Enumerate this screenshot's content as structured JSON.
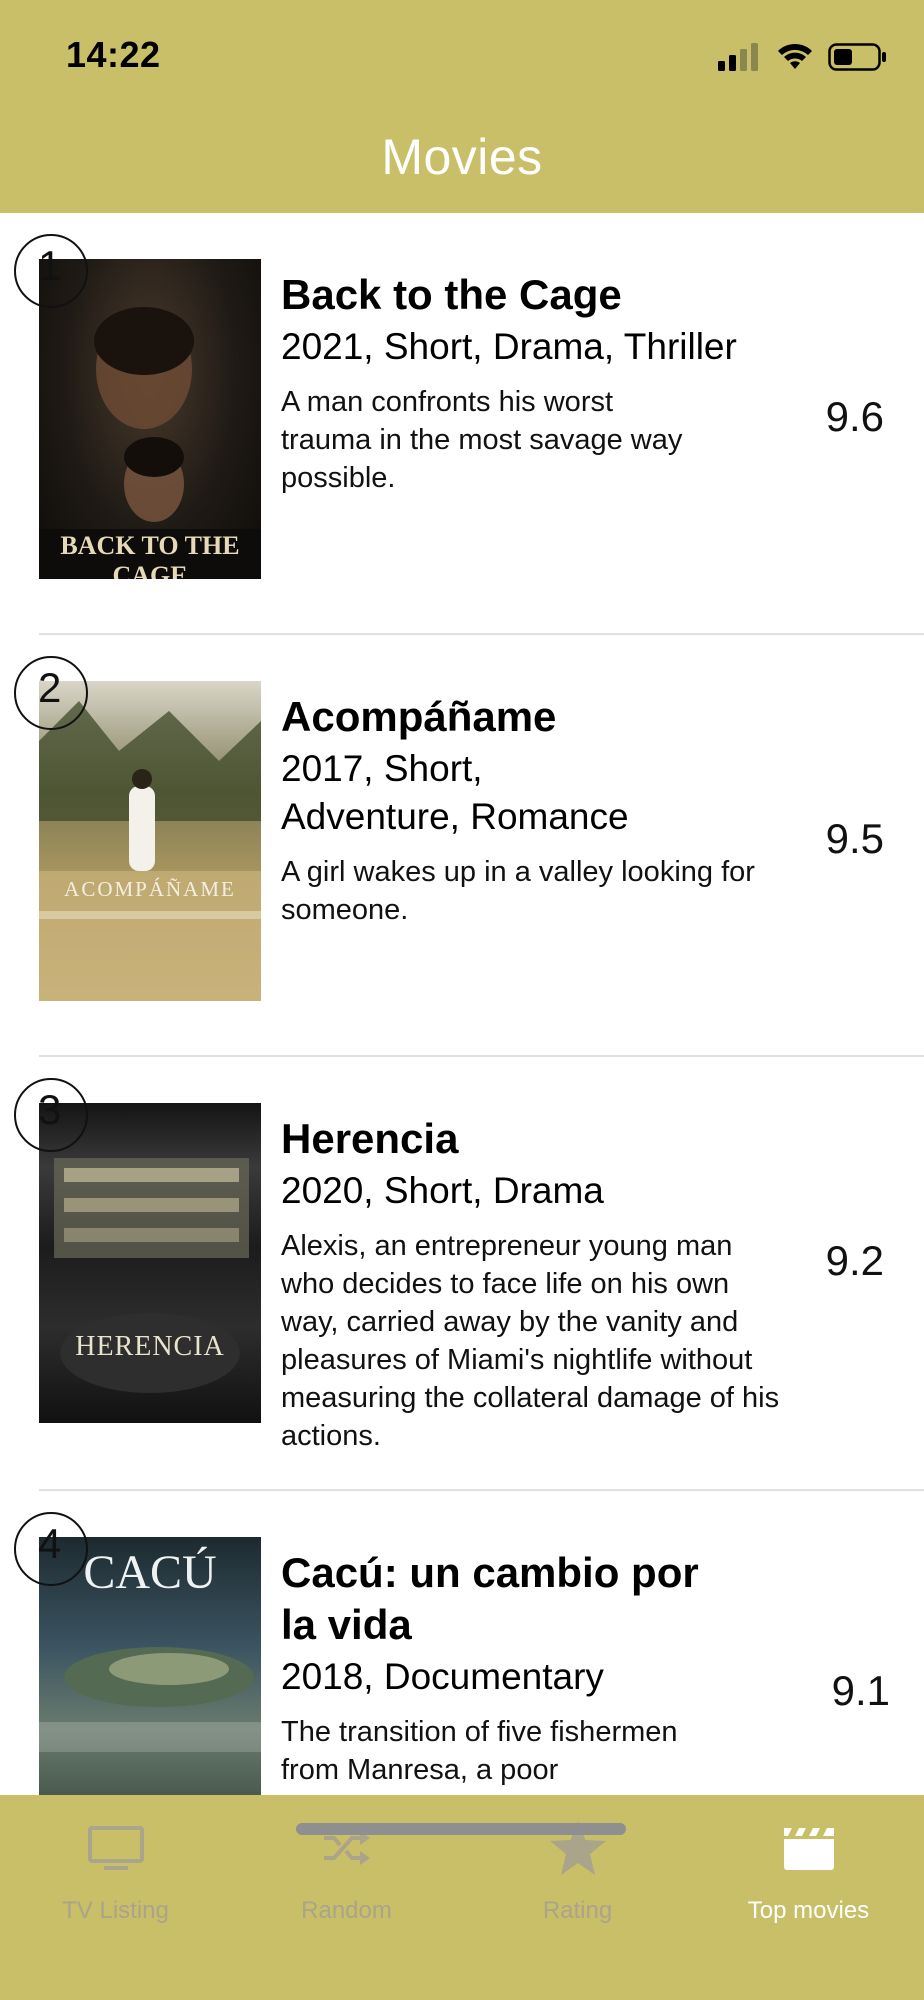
{
  "status_bar": {
    "time": "14:22"
  },
  "nav": {
    "title": "Movies"
  },
  "movies": [
    {
      "rank": "1",
      "title": "Back to the Cage",
      "meta": "2021, Short, Drama, Thriller",
      "description": "A man confronts his worst trauma in the most savage way possible.",
      "rating": "9.6",
      "poster_text": "BACK TO THE CAGE"
    },
    {
      "rank": "2",
      "title": "Acompáñame",
      "meta": "2017, Short, Adventure, Romance",
      "description": "A girl wakes up in a valley looking for someone.",
      "rating": "9.5",
      "poster_text": "ACOMPÁÑAME"
    },
    {
      "rank": "3",
      "title": "Herencia",
      "meta": "2020, Short, Drama",
      "description": "Alexis, an entrepreneur young man who decides to face life on his own way, carried away by the vanity and pleasures of Miami's nightlife without measuring the collateral damage of his actions.",
      "rating": "9.2",
      "poster_text": "HERENCIA"
    },
    {
      "rank": "4",
      "title": "Cacú: un cambio por la vida",
      "meta": "2018, Documentary",
      "description": "The transition of five fishermen from Manresa, a poor",
      "rating": "9.1",
      "poster_text": "CACÚ"
    }
  ],
  "tabs": [
    {
      "label": "TV Listing",
      "icon": "tv-icon",
      "active": false
    },
    {
      "label": "Random",
      "icon": "shuffle-icon",
      "active": false
    },
    {
      "label": "Rating",
      "icon": "star-icon",
      "active": false
    },
    {
      "label": "Top movies",
      "icon": "clapperboard-icon",
      "active": true
    }
  ],
  "colors": {
    "accent": "#c9bf68",
    "tab_inactive": "#a9a48a",
    "tab_active": "#ffffff"
  }
}
